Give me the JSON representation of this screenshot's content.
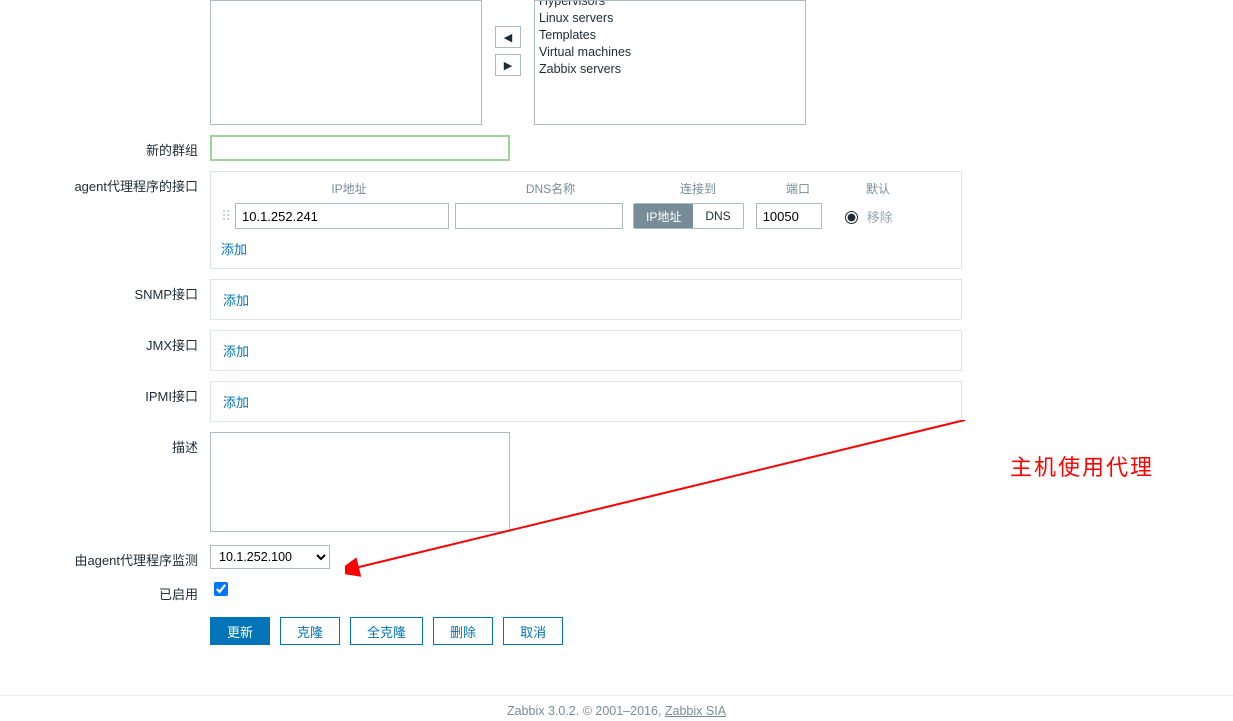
{
  "groups_right_options": [
    "Hypervisors",
    "Linux servers",
    "Templates",
    "Virtual machines",
    "Zabbix servers"
  ],
  "labels": {
    "new_group": "新的群组",
    "agent_iface": "agent代理程序的接口",
    "snmp_iface": "SNMP接口",
    "jmx_iface": "JMX接口",
    "ipmi_iface": "IPMI接口",
    "description": "描述",
    "monitored_by_proxy": "由agent代理程序监测",
    "enabled": "已启用"
  },
  "iface_headers": {
    "ip": "IP地址",
    "dns": "DNS名称",
    "connect_to": "连接到",
    "port": "端口",
    "default": "默认"
  },
  "agent_interface": {
    "ip": "10.1.252.241",
    "dns": "",
    "connect_to_ip_label": "IP地址",
    "connect_to_dns_label": "DNS",
    "port": "10050",
    "remove_label": "移除"
  },
  "add_link": "添加",
  "proxy": {
    "selected": "10.1.252.100"
  },
  "buttons": {
    "update": "更新",
    "clone": "克隆",
    "full_clone": "全克隆",
    "delete": "删除",
    "cancel": "取消"
  },
  "annotation": "主机使用代理",
  "footer": {
    "text": "Zabbix 3.0.2. © 2001–2016, ",
    "link": "Zabbix SIA"
  },
  "arrows": {
    "left": "◀",
    "right": "▶"
  }
}
